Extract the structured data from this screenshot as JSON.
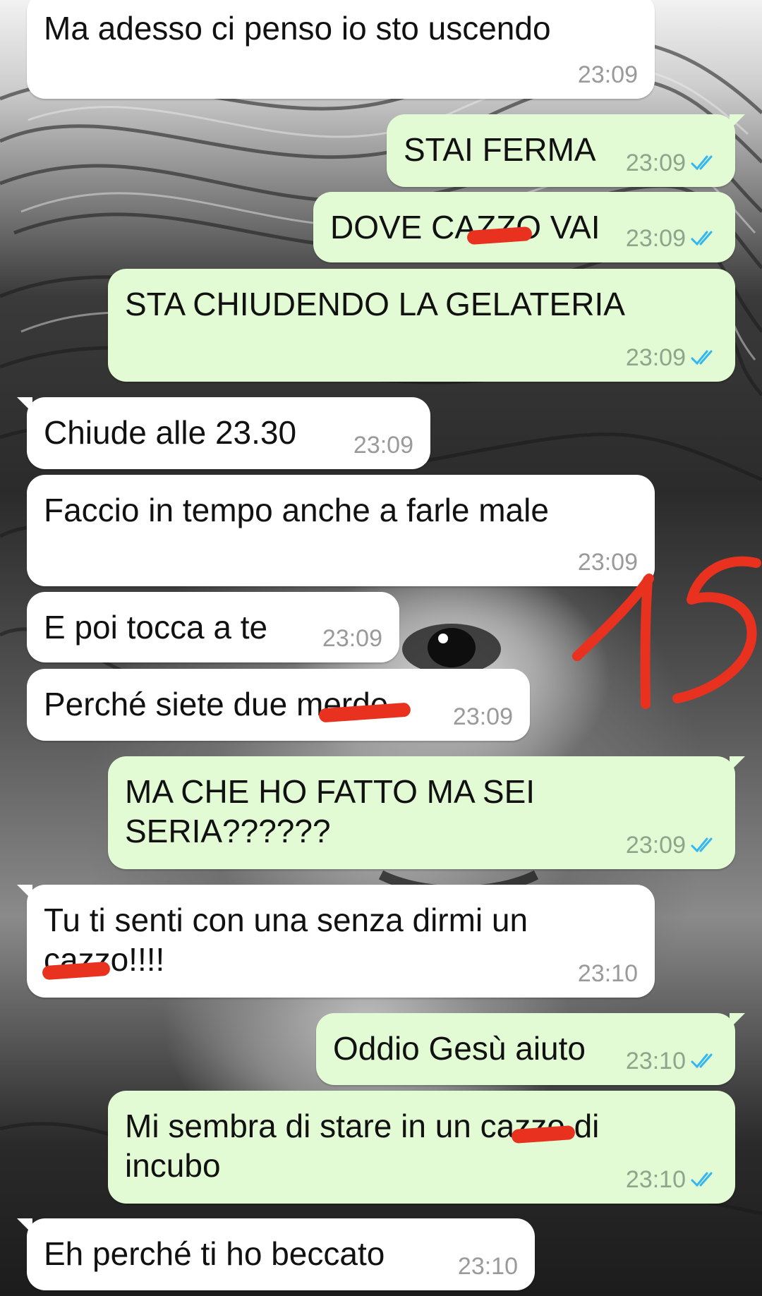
{
  "chat": {
    "messages": [
      {
        "direction": "in",
        "text": "Ma adesso ci penso io sto uscendo",
        "time": "23:09"
      },
      {
        "direction": "out",
        "text": "STAI FERMA",
        "time": "23:09",
        "read": true
      },
      {
        "direction": "out",
        "text": "DOVE CAZZO VAI",
        "time": "23:09",
        "read": true
      },
      {
        "direction": "out",
        "text": "STA CHIUDENDO LA GELATERIA",
        "time": "23:09",
        "read": true
      },
      {
        "direction": "in",
        "text": "Chiude alle 23.30",
        "time": "23:09"
      },
      {
        "direction": "in",
        "text": "Faccio in tempo anche a farle male",
        "time": "23:09"
      },
      {
        "direction": "in",
        "text": "E poi tocca a te",
        "time": "23:09"
      },
      {
        "direction": "in",
        "text": "Perché siete due merde",
        "time": "23:09"
      },
      {
        "direction": "out",
        "text": "MA CHE HO FATTO MA SEI\nSERIA??????",
        "time": "23:09",
        "read": true
      },
      {
        "direction": "in",
        "text": "Tu ti senti con una senza dirmi un\ncazzo!!!!",
        "time": "23:10"
      },
      {
        "direction": "out",
        "text": "Oddio Gesù aiuto",
        "time": "23:10",
        "read": true
      },
      {
        "direction": "out",
        "text": "Mi sembra di stare in un cazzo di\nincubo",
        "time": "23:10",
        "read": true
      },
      {
        "direction": "in",
        "text": "Eh perché ti ho beccato",
        "time": "23:10"
      }
    ]
  },
  "annotation": {
    "text": "15",
    "color": "#e8321f"
  },
  "colors": {
    "incoming_bubble": "#ffffff",
    "outgoing_bubble": "#e2fbd4",
    "read_ticks": "#34b7f1",
    "timestamp": "#9a9a9a",
    "censor_scribble": "#e8321f"
  }
}
